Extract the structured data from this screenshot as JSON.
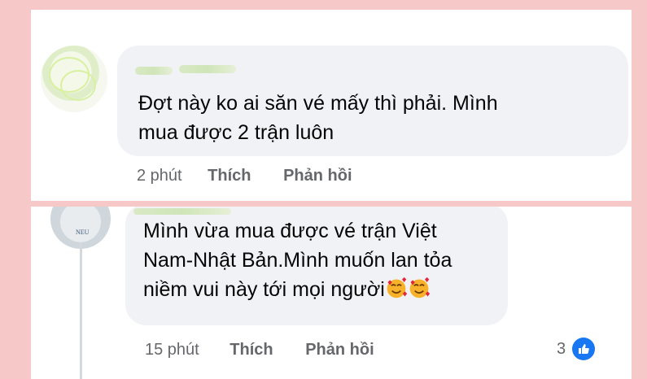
{
  "comments": [
    {
      "text_lines": [
        "Đợt này ko ai săn vé mấy thì phải. Mình",
        "mua được 2 trận luôn"
      ],
      "time": "2 phút",
      "like_label": "Thích",
      "reply_label": "Phản hồi"
    },
    {
      "text_lines": [
        "Mình vừa mua được vé   trận Việt",
        "Nam-Nhật Bản.Mình muốn lan tỏa",
        "niềm vui này tới mọi người"
      ],
      "avatar_label": "NEU",
      "time": "15 phút",
      "like_label": "Thích",
      "reply_label": "Phản hồi",
      "reaction_count": "3",
      "reaction_icon": "like-icon",
      "trailing_emoji": [
        "smiling-face-with-hearts-icon",
        "smiling-face-with-hearts-icon"
      ]
    }
  ],
  "colors": {
    "page_bg": "#f6c8c8",
    "bubble": "#f0f2f5",
    "text": "#050505",
    "secondary_text": "#65676b",
    "like_blue": "#1877f2"
  }
}
